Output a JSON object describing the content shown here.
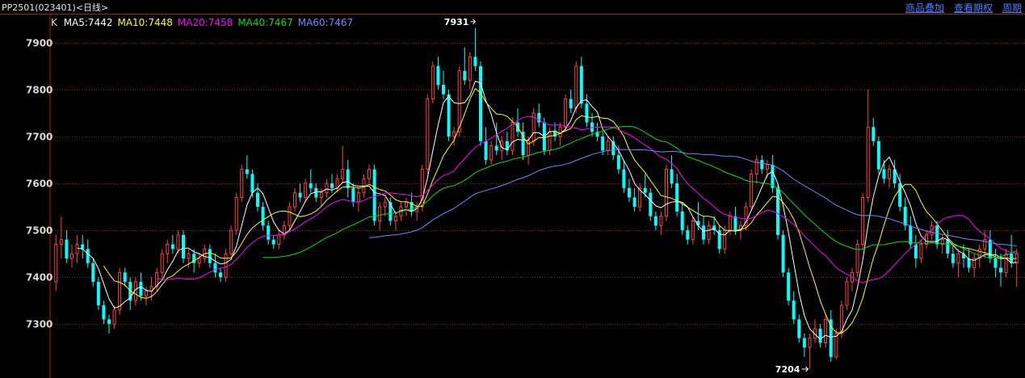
{
  "header": {
    "title": "PP2501(023401)<日线>",
    "menu": [
      "商品叠加",
      "查看期权",
      "周期"
    ]
  },
  "chart_data": {
    "type": "candlestick",
    "ylim": [
      7185,
      7960
    ],
    "yticks": [
      7300,
      7400,
      7500,
      7600,
      7700,
      7800,
      7900
    ],
    "grid": true,
    "legend": {
      "prefix": "K",
      "items": [
        {
          "name": "MA5",
          "value": "7442",
          "color": "#ffffff"
        },
        {
          "name": "MA10",
          "value": "7448",
          "color": "#ffff00"
        },
        {
          "name": "MA20",
          "value": "7458",
          "color": "#ff00ff"
        },
        {
          "name": "MA40",
          "value": "7467",
          "color": "#00e000"
        },
        {
          "name": "MA60",
          "value": "7467",
          "color": "#8080ff"
        }
      ]
    },
    "annotations": [
      {
        "label": "7931",
        "value": 7931
      },
      {
        "label": "7204",
        "value": 7204
      }
    ],
    "up_color": "#ff4040",
    "down_color": "#00ffff",
    "candles": [
      [
        7390,
        7490,
        7370,
        7470
      ],
      [
        7470,
        7530,
        7440,
        7480
      ],
      [
        7480,
        7500,
        7430,
        7440
      ],
      [
        7440,
        7470,
        7420,
        7450
      ],
      [
        7450,
        7490,
        7430,
        7470
      ],
      [
        7470,
        7490,
        7440,
        7460
      ],
      [
        7460,
        7480,
        7420,
        7430
      ],
      [
        7430,
        7440,
        7380,
        7390
      ],
      [
        7390,
        7400,
        7330,
        7340
      ],
      [
        7340,
        7350,
        7300,
        7310
      ],
      [
        7310,
        7320,
        7280,
        7300
      ],
      [
        7300,
        7340,
        7290,
        7330
      ],
      [
        7330,
        7420,
        7320,
        7410
      ],
      [
        7410,
        7420,
        7380,
        7390
      ],
      [
        7390,
        7400,
        7330,
        7350
      ],
      [
        7350,
        7400,
        7340,
        7390
      ],
      [
        7390,
        7410,
        7350,
        7360
      ],
      [
        7360,
        7380,
        7340,
        7370
      ],
      [
        7370,
        7400,
        7350,
        7380
      ],
      [
        7380,
        7420,
        7370,
        7410
      ],
      [
        7410,
        7460,
        7400,
        7450
      ],
      [
        7450,
        7480,
        7430,
        7470
      ],
      [
        7470,
        7490,
        7450,
        7460
      ],
      [
        7460,
        7500,
        7450,
        7490
      ],
      [
        7490,
        7500,
        7430,
        7440
      ],
      [
        7440,
        7460,
        7420,
        7450
      ],
      [
        7450,
        7460,
        7410,
        7430
      ],
      [
        7430,
        7450,
        7420,
        7440
      ],
      [
        7440,
        7470,
        7430,
        7460
      ],
      [
        7460,
        7470,
        7420,
        7430
      ],
      [
        7430,
        7450,
        7400,
        7410
      ],
      [
        7410,
        7420,
        7390,
        7400
      ],
      [
        7400,
        7460,
        7390,
        7450
      ],
      [
        7450,
        7510,
        7440,
        7500
      ],
      [
        7500,
        7580,
        7490,
        7570
      ],
      [
        7570,
        7640,
        7560,
        7630
      ],
      [
        7630,
        7660,
        7610,
        7620
      ],
      [
        7620,
        7630,
        7570,
        7580
      ],
      [
        7580,
        7600,
        7540,
        7550
      ],
      [
        7550,
        7560,
        7500,
        7510
      ],
      [
        7510,
        7520,
        7470,
        7480
      ],
      [
        7480,
        7490,
        7460,
        7470
      ],
      [
        7470,
        7500,
        7460,
        7490
      ],
      [
        7490,
        7520,
        7480,
        7510
      ],
      [
        7510,
        7560,
        7500,
        7550
      ],
      [
        7550,
        7590,
        7540,
        7580
      ],
      [
        7580,
        7600,
        7560,
        7570
      ],
      [
        7570,
        7610,
        7560,
        7600
      ],
      [
        7600,
        7630,
        7580,
        7590
      ],
      [
        7590,
        7600,
        7560,
        7570
      ],
      [
        7570,
        7590,
        7550,
        7580
      ],
      [
        7580,
        7610,
        7570,
        7600
      ],
      [
        7600,
        7620,
        7580,
        7590
      ],
      [
        7590,
        7620,
        7580,
        7610
      ],
      [
        7610,
        7680,
        7600,
        7630
      ],
      [
        7630,
        7650,
        7570,
        7590
      ],
      [
        7590,
        7600,
        7550,
        7560
      ],
      [
        7560,
        7590,
        7540,
        7580
      ],
      [
        7580,
        7620,
        7570,
        7610
      ],
      [
        7610,
        7640,
        7600,
        7630
      ],
      [
        7630,
        7640,
        7510,
        7520
      ],
      [
        7520,
        7560,
        7500,
        7550
      ],
      [
        7550,
        7570,
        7530,
        7560
      ],
      [
        7560,
        7570,
        7510,
        7520
      ],
      [
        7520,
        7540,
        7500,
        7530
      ],
      [
        7530,
        7560,
        7520,
        7550
      ],
      [
        7550,
        7570,
        7530,
        7560
      ],
      [
        7560,
        7580,
        7530,
        7540
      ],
      [
        7540,
        7560,
        7520,
        7550
      ],
      [
        7550,
        7640,
        7540,
        7630
      ],
      [
        7630,
        7790,
        7620,
        7780
      ],
      [
        7780,
        7860,
        7770,
        7850
      ],
      [
        7850,
        7870,
        7800,
        7810
      ],
      [
        7810,
        7840,
        7780,
        7790
      ],
      [
        7790,
        7800,
        7690,
        7700
      ],
      [
        7700,
        7720,
        7680,
        7710
      ],
      [
        7710,
        7850,
        7700,
        7840
      ],
      [
        7840,
        7890,
        7810,
        7820
      ],
      [
        7820,
        7880,
        7800,
        7870
      ],
      [
        7870,
        7931,
        7840,
        7850
      ],
      [
        7850,
        7860,
        7680,
        7690
      ],
      [
        7690,
        7720,
        7640,
        7650
      ],
      [
        7650,
        7690,
        7640,
        7680
      ],
      [
        7680,
        7730,
        7660,
        7670
      ],
      [
        7670,
        7700,
        7650,
        7690
      ],
      [
        7690,
        7710,
        7660,
        7670
      ],
      [
        7670,
        7740,
        7660,
        7730
      ],
      [
        7730,
        7760,
        7700,
        7710
      ],
      [
        7710,
        7730,
        7650,
        7660
      ],
      [
        7660,
        7700,
        7640,
        7690
      ],
      [
        7690,
        7760,
        7680,
        7750
      ],
      [
        7750,
        7770,
        7720,
        7730
      ],
      [
        7730,
        7740,
        7660,
        7670
      ],
      [
        7670,
        7720,
        7660,
        7710
      ],
      [
        7710,
        7730,
        7690,
        7700
      ],
      [
        7700,
        7730,
        7680,
        7720
      ],
      [
        7720,
        7790,
        7710,
        7780
      ],
      [
        7780,
        7800,
        7750,
        7760
      ],
      [
        7760,
        7860,
        7750,
        7850
      ],
      [
        7850,
        7870,
        7760,
        7770
      ],
      [
        7770,
        7790,
        7720,
        7730
      ],
      [
        7730,
        7750,
        7700,
        7710
      ],
      [
        7710,
        7730,
        7690,
        7700
      ],
      [
        7700,
        7710,
        7660,
        7670
      ],
      [
        7670,
        7700,
        7660,
        7690
      ],
      [
        7690,
        7700,
        7650,
        7660
      ],
      [
        7660,
        7680,
        7620,
        7630
      ],
      [
        7630,
        7650,
        7580,
        7590
      ],
      [
        7590,
        7610,
        7560,
        7570
      ],
      [
        7570,
        7590,
        7540,
        7550
      ],
      [
        7550,
        7600,
        7540,
        7590
      ],
      [
        7590,
        7620,
        7570,
        7580
      ],
      [
        7580,
        7590,
        7520,
        7530
      ],
      [
        7530,
        7540,
        7500,
        7510
      ],
      [
        7510,
        7540,
        7490,
        7530
      ],
      [
        7530,
        7640,
        7520,
        7630
      ],
      [
        7630,
        7660,
        7590,
        7600
      ],
      [
        7600,
        7620,
        7530,
        7540
      ],
      [
        7540,
        7560,
        7490,
        7500
      ],
      [
        7500,
        7510,
        7470,
        7480
      ],
      [
        7480,
        7530,
        7470,
        7520
      ],
      [
        7520,
        7560,
        7500,
        7510
      ],
      [
        7510,
        7530,
        7470,
        7480
      ],
      [
        7480,
        7520,
        7470,
        7510
      ],
      [
        7510,
        7530,
        7490,
        7500
      ],
      [
        7500,
        7510,
        7450,
        7460
      ],
      [
        7460,
        7510,
        7450,
        7500
      ],
      [
        7500,
        7540,
        7490,
        7530
      ],
      [
        7530,
        7550,
        7490,
        7500
      ],
      [
        7500,
        7520,
        7480,
        7510
      ],
      [
        7510,
        7560,
        7500,
        7550
      ],
      [
        7550,
        7630,
        7540,
        7620
      ],
      [
        7620,
        7660,
        7600,
        7650
      ],
      [
        7650,
        7660,
        7620,
        7630
      ],
      [
        7630,
        7650,
        7610,
        7640
      ],
      [
        7640,
        7660,
        7580,
        7590
      ],
      [
        7590,
        7600,
        7480,
        7490
      ],
      [
        7490,
        7500,
        7400,
        7410
      ],
      [
        7410,
        7420,
        7340,
        7350
      ],
      [
        7350,
        7370,
        7300,
        7310
      ],
      [
        7310,
        7320,
        7260,
        7270
      ],
      [
        7270,
        7280,
        7230,
        7250
      ],
      [
        7250,
        7280,
        7204,
        7270
      ],
      [
        7270,
        7310,
        7260,
        7290
      ],
      [
        7290,
        7300,
        7250,
        7260
      ],
      [
        7260,
        7320,
        7250,
        7310
      ],
      [
        7310,
        7330,
        7220,
        7230
      ],
      [
        7230,
        7290,
        7225,
        7280
      ],
      [
        7280,
        7350,
        7270,
        7340
      ],
      [
        7340,
        7400,
        7330,
        7390
      ],
      [
        7390,
        7420,
        7370,
        7410
      ],
      [
        7410,
        7480,
        7400,
        7470
      ],
      [
        7470,
        7580,
        7460,
        7570
      ],
      [
        7570,
        7800,
        7560,
        7720
      ],
      [
        7720,
        7740,
        7680,
        7690
      ],
      [
        7690,
        7700,
        7620,
        7630
      ],
      [
        7630,
        7650,
        7600,
        7610
      ],
      [
        7610,
        7640,
        7590,
        7630
      ],
      [
        7630,
        7650,
        7590,
        7600
      ],
      [
        7600,
        7620,
        7540,
        7550
      ],
      [
        7550,
        7570,
        7500,
        7510
      ],
      [
        7510,
        7530,
        7460,
        7470
      ],
      [
        7470,
        7490,
        7420,
        7440
      ],
      [
        7440,
        7480,
        7430,
        7470
      ],
      [
        7470,
        7500,
        7460,
        7490
      ],
      [
        7490,
        7520,
        7480,
        7510
      ],
      [
        7510,
        7520,
        7460,
        7470
      ],
      [
        7470,
        7490,
        7450,
        7480
      ],
      [
        7480,
        7500,
        7440,
        7450
      ],
      [
        7450,
        7470,
        7420,
        7430
      ],
      [
        7430,
        7460,
        7400,
        7450
      ],
      [
        7450,
        7470,
        7420,
        7440
      ],
      [
        7440,
        7460,
        7410,
        7420
      ],
      [
        7420,
        7450,
        7400,
        7440
      ],
      [
        7440,
        7470,
        7420,
        7460
      ],
      [
        7460,
        7500,
        7440,
        7480
      ],
      [
        7480,
        7500,
        7430,
        7440
      ],
      [
        7440,
        7460,
        7400,
        7420
      ],
      [
        7420,
        7450,
        7380,
        7410
      ],
      [
        7410,
        7460,
        7400,
        7450
      ],
      [
        7450,
        7490,
        7420,
        7430
      ],
      [
        7430,
        7460,
        7380,
        7450
      ]
    ]
  }
}
